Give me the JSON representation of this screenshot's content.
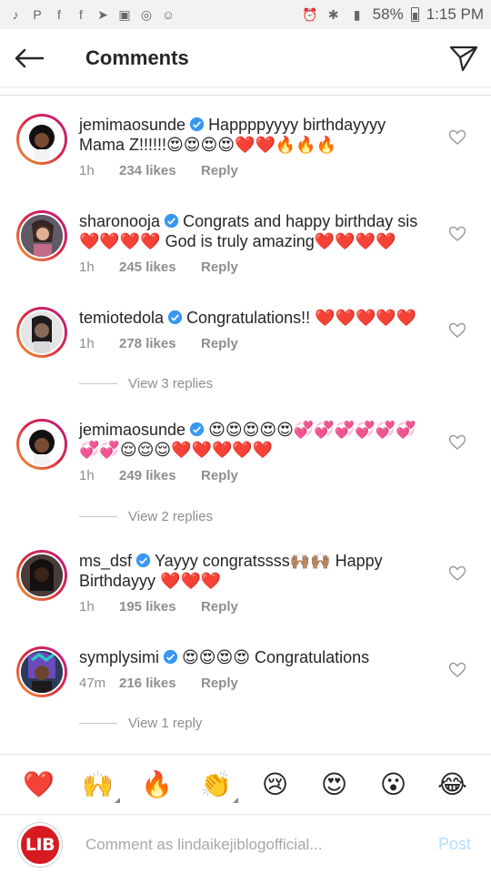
{
  "status_bar": {
    "battery": "58%",
    "time": "1:15 PM"
  },
  "header": {
    "title": "Comments"
  },
  "comments": [
    {
      "username": "jemimaosunde",
      "text": "Happppyyyy birthdayyyy Mama Z!!!!!!😍😍😍😍❤️❤️🔥🔥🔥",
      "time": "1h",
      "likes": "234 likes",
      "reply": "Reply"
    },
    {
      "username": "sharonooja",
      "text": "Congrats and happy birthday sis❤️❤️❤️❤️ God is truly amazing❤️❤️❤️❤️",
      "time": "1h",
      "likes": "245 likes",
      "reply": "Reply"
    },
    {
      "username": "temiotedola",
      "text": "Congratulations!! ❤️❤️❤️❤️❤️",
      "time": "1h",
      "likes": "278 likes",
      "reply": "Reply",
      "view_replies": "View 3 replies"
    },
    {
      "username": "jemimaosunde",
      "text": "😍😍😍😍😍💞💞💞💞💞💞💞💞😌😌😌❤️❤️❤️❤️❤️",
      "time": "1h",
      "likes": "249 likes",
      "reply": "Reply",
      "view_replies": "View 2 replies"
    },
    {
      "username": "ms_dsf",
      "text": "Yayyy congratssss🙌🏽🙌🏽 Happy Birthdayyy ❤️❤️❤️",
      "time": "1h",
      "likes": "195 likes",
      "reply": "Reply"
    },
    {
      "username": "symplysimi",
      "text": "😍😍😍😍 Congratulations",
      "time": "47m",
      "likes": "216 likes",
      "reply": "Reply",
      "view_replies": "View 1 reply"
    }
  ],
  "emoji_bar": [
    "❤️",
    "🙌",
    "🔥",
    "👏",
    "😢",
    "😍",
    "😮",
    "😂"
  ],
  "input": {
    "avatar_text": "LIB",
    "placeholder": "Comment as lindaikejiblogofficial...",
    "post_label": "Post"
  }
}
